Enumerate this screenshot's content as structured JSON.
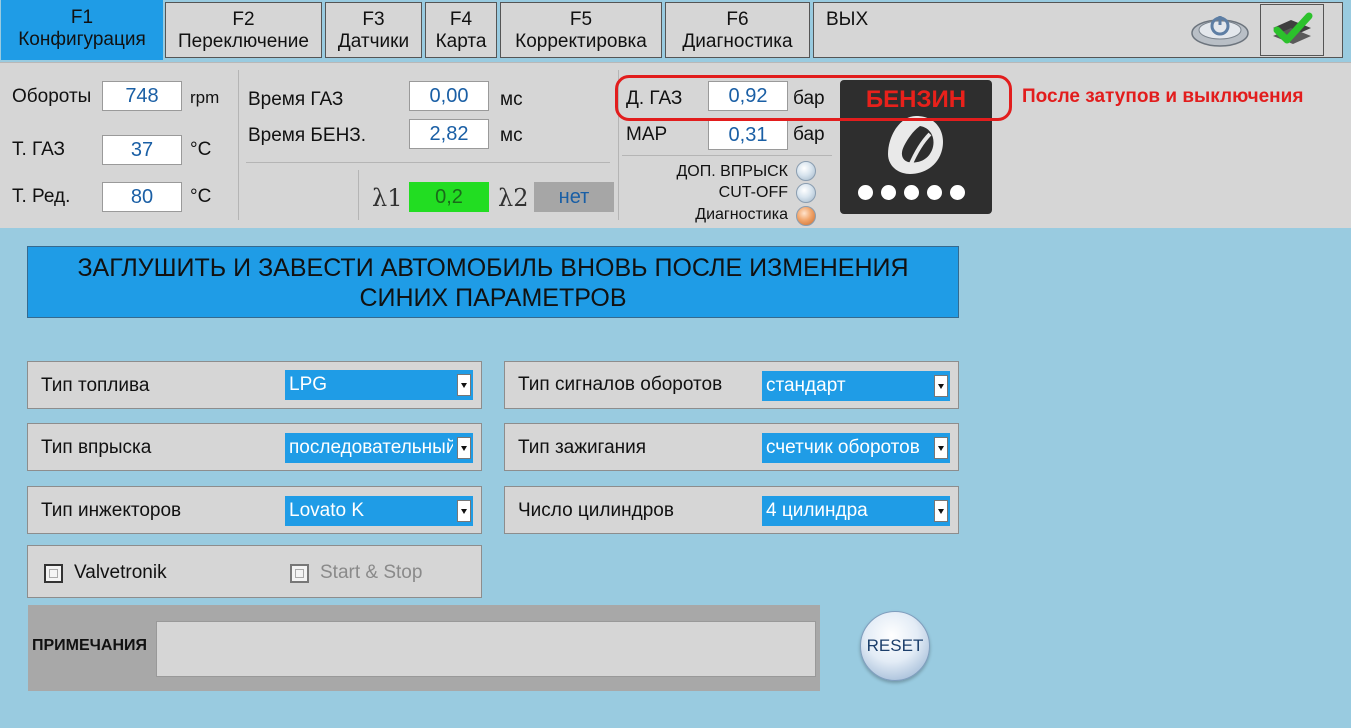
{
  "tabs": [
    {
      "key": "F1",
      "label": "Конфигурация"
    },
    {
      "key": "F2",
      "label": "Переключение"
    },
    {
      "key": "F3",
      "label": "Датчики"
    },
    {
      "key": "F4",
      "label": "Карта"
    },
    {
      "key": "F5",
      "label": "Корректировка"
    },
    {
      "key": "F6",
      "label": "Диагностика"
    }
  ],
  "exit_label": "ВЫХ",
  "status": {
    "rpm": {
      "label": "Обороты",
      "value": "748",
      "unit": "rpm"
    },
    "t_gas": {
      "label": "Т. ГАЗ",
      "value": "37",
      "unit": "°C"
    },
    "t_red": {
      "label": "Т. Ред.",
      "value": "80",
      "unit": "°C"
    },
    "time_gas": {
      "label": "Время ГАЗ",
      "value": "0,00",
      "unit": "мс"
    },
    "time_benz": {
      "label": "Время БЕНЗ.",
      "value": "2,82",
      "unit": "мс"
    },
    "lambda1": {
      "label": "λ1",
      "value": "0,2"
    },
    "lambda2": {
      "label": "λ2",
      "value": "нет"
    },
    "p_gas": {
      "label": "Д. ГАЗ",
      "value": "0,92",
      "unit": "бар"
    },
    "map": {
      "label": "MAP",
      "value": "0,31",
      "unit": "бар"
    },
    "indicators": [
      {
        "label": "ДОП. ВПРЫСК",
        "state": "off"
      },
      {
        "label": "CUT-OFF",
        "state": "off"
      },
      {
        "label": "Диагностика",
        "state": "on"
      }
    ],
    "fuel_mode": "БЕНЗИН",
    "annotation": "После затупов и выключения"
  },
  "banner": {
    "line1": "ЗАГЛУШИТЬ И ЗАВЕСТИ АВТОМОБИЛЬ ВНОВЬ ПОСЛЕ ИЗМЕНЕНИЯ",
    "line2": "СИНИХ ПАРАМЕТРОВ"
  },
  "settings": {
    "fuel_type": {
      "label": "Тип топлива",
      "value": "LPG"
    },
    "injection_type": {
      "label": "Тип впрыска",
      "value": "последовательный"
    },
    "injector_type": {
      "label": "Тип инжекторов",
      "value": "Lovato K"
    },
    "rpm_signal": {
      "label": "Тип сигналов оборотов",
      "value": "стандарт"
    },
    "ignition_type": {
      "label": "Тип зажигания",
      "value": "счетчик оборотов"
    },
    "cylinders": {
      "label": "Число цилиндров",
      "value": "4 цилиндра"
    },
    "valvetronik": {
      "label": "Valvetronik",
      "checked": false
    },
    "start_stop": {
      "label": "Start & Stop",
      "checked": false
    }
  },
  "notes": {
    "label": "ПРИМЕЧАНИЯ",
    "value": ""
  },
  "reset_label": "RESET",
  "colors": {
    "accent": "#1f9ce6",
    "background": "#99cbe0",
    "panel": "#d6d6d6",
    "lambda_ok": "#22dd22",
    "alert": "#e21d1d"
  }
}
